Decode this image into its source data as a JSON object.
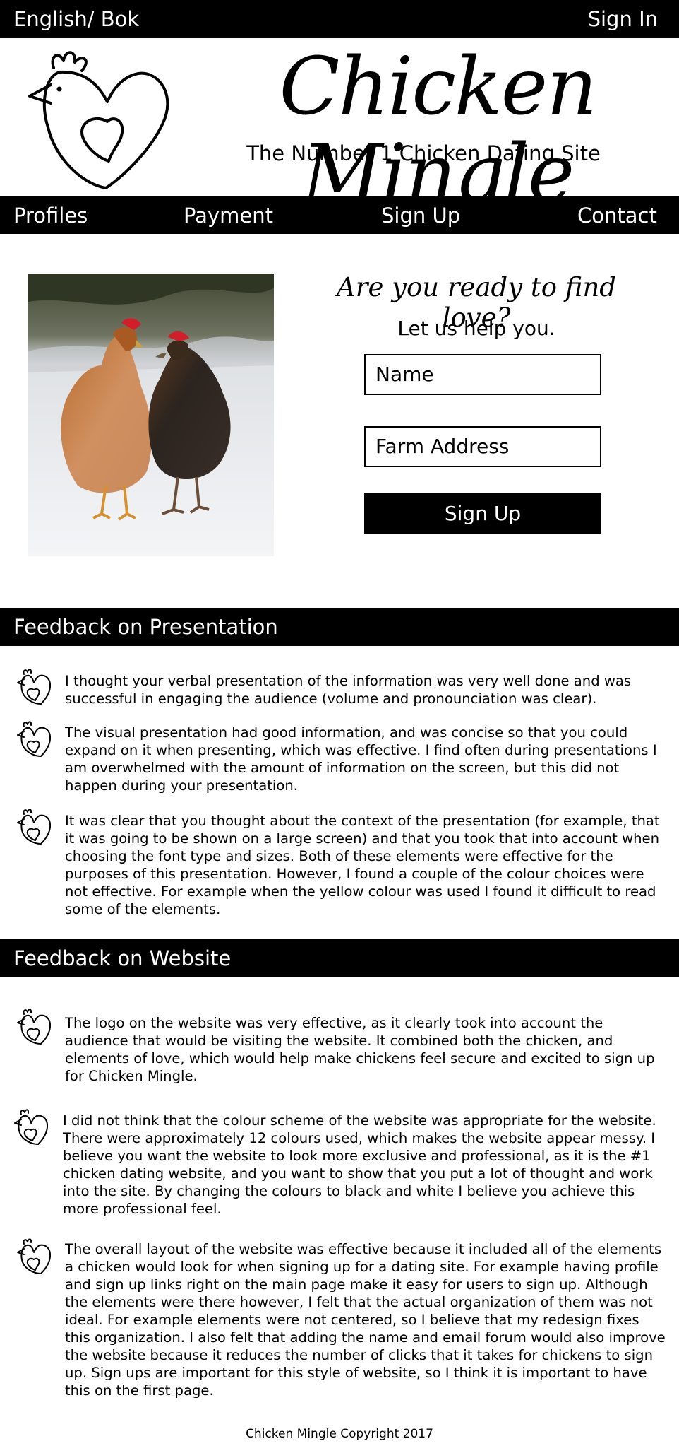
{
  "topbar": {
    "language": "English/ Bok",
    "sign_in": "Sign In"
  },
  "header": {
    "title": "Chicken Mingle",
    "tagline": "The Number 1 Chicken Dating Site"
  },
  "nav": [
    {
      "label": "Profiles"
    },
    {
      "label": "Payment"
    },
    {
      "label": "Sign Up"
    },
    {
      "label": "Contact"
    }
  ],
  "hero": {
    "heading": "Are you ready to find love?",
    "subheading": "Let us help you.",
    "name_placeholder": "Name",
    "address_placeholder": "Farm Address",
    "signup_label": "Sign Up"
  },
  "presentation": {
    "heading": "Feedback on Presentation",
    "items": [
      {
        "text": "I thought your verbal presentation of the information was very well done and was successful in engaging the audience (volume and pronounciation was clear)."
      },
      {
        "text": "The visual presentation had good information, and was concise so that you could expand on it when presenting, which was effective. I find often during presentations I am overwhelmed with the amount of information on the screen, but this did not happen during your presentation."
      },
      {
        "text": "It was clear that you thought about the context of the presentation (for example, that it was going to be shown on a large screen) and that you took that into account when choosing the font type and sizes. Both of these elements were effective for the purposes of this presentation. However, I found a couple of the colour choices were not effective. For example when the yellow colour was used I found it difficult to read some of the elements."
      }
    ]
  },
  "website": {
    "heading": "Feedback on Website",
    "items": [
      {
        "text": "The logo on the website was very effective, as it clearly took into account the audience that would be visiting the website. It combined both the chicken, and elements of love, which would help make chickens feel secure and excited to sign up for Chicken Mingle."
      },
      {
        "text": "I did not think that the colour scheme of the website was appropriate for the website. There were approximately 12 colours used, which makes the website appear messy. I believe you want the website to look more exclusive and professional, as it is the #1 chicken dating website, and you want to show that you put a lot of thought and work into the site. By changing the colours to black and white I believe you achieve this more professional feel."
      },
      {
        "text": "The overall layout of the website was effective because it included all of the elements a chicken would look for when signing up for a dating site. For example having profile and sign up links right on the main page make it easy for users to sign up. Although the elements were there however, I felt that the actual organization of them was not ideal. For example elements were not centered, so I believe that my redesign fixes this organization. I also felt that adding the name and email forum would also improve the website because it reduces the number of clicks that it takes for chickens to sign up. Sign ups are important for this style of website, so I think it is important to have this on the first page."
      }
    ]
  },
  "footer": {
    "copyright": "Chicken Mingle Copyright 2017"
  },
  "colors": {
    "primary": "#000000",
    "background": "#ffffff"
  },
  "icons": {
    "bullet": "heart-chicken-icon",
    "logo": "chicken-heart-logo"
  }
}
